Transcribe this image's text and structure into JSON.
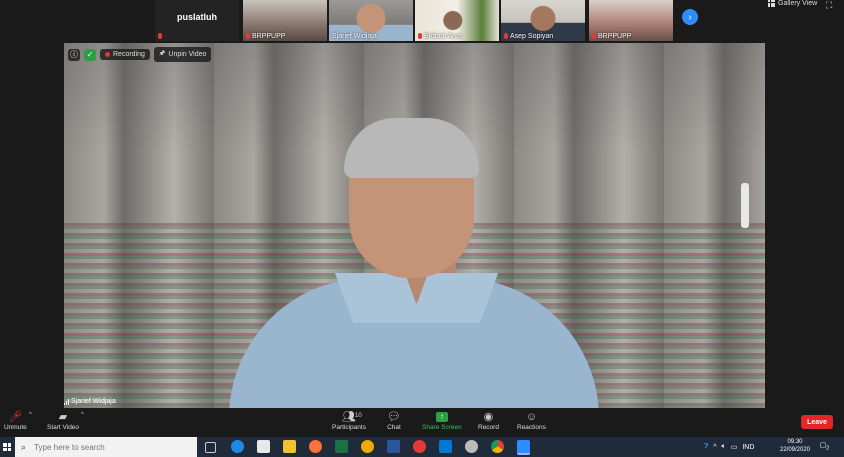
{
  "thumbnails": [
    {
      "name": "",
      "center_name": "pusIatluh",
      "mic_muted": true,
      "active": false
    },
    {
      "name": "BRPPUPP",
      "mic_muted": true,
      "active": false
    },
    {
      "name": "Sjarief Widjaja",
      "mic_muted": false,
      "active": true
    },
    {
      "name": "Erdiani Arya",
      "mic_muted": true,
      "active": false
    },
    {
      "name": "Asep Sopiyan",
      "mic_muted": true,
      "active": false
    },
    {
      "name": "BRPPUPP",
      "mic_muted": true,
      "active": false
    }
  ],
  "gallery_view_label": "Gallery View",
  "main_video": {
    "recording_label": "Recording",
    "unpin_label": "Unpin Video",
    "speaker_name": "Sjarief Widjaja"
  },
  "controls": {
    "unmute": "Unmute",
    "start_video": "Start Video",
    "participants": "Participants",
    "participants_count": "10",
    "chat": "Chat",
    "share_screen": "Share Screen",
    "record": "Record",
    "reactions": "Reactions",
    "leave": "Leave"
  },
  "taskbar": {
    "search_placeholder": "Type here to search",
    "language": "IND",
    "time": "09.30",
    "date": "22/09/2020",
    "notification_count": "2"
  }
}
